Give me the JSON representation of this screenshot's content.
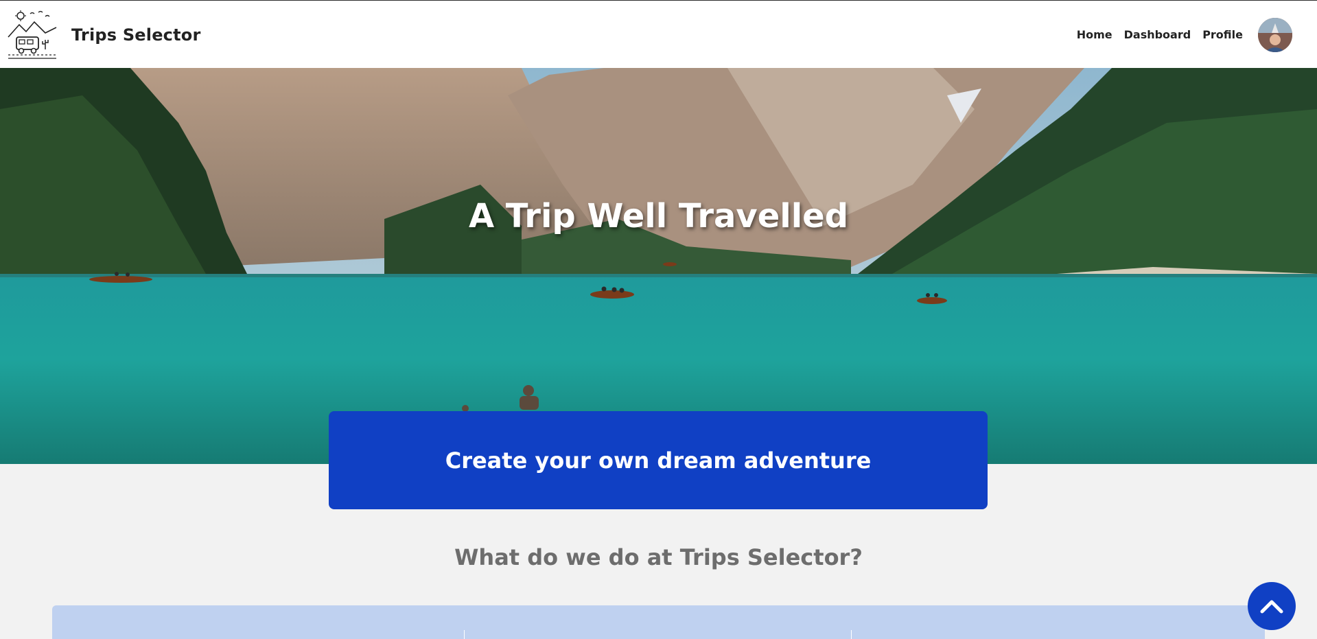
{
  "header": {
    "brand_title": "Trips Selector",
    "logo_icon": "camper-van-mountains-logo",
    "nav": [
      {
        "label": "Home"
      },
      {
        "label": "Dashboard"
      },
      {
        "label": "Profile"
      }
    ],
    "avatar_icon": "user-avatar"
  },
  "hero": {
    "title": "A Trip Well Travelled",
    "image": "mountain-lake-with-boats"
  },
  "cta": {
    "label": "Create your own dream adventure"
  },
  "section": {
    "title": "What do we do at Trips Selector?"
  },
  "scroll_top": {
    "icon": "chevron-up-icon"
  },
  "colors": {
    "primary": "#1040c4",
    "feature_bg": "#bfd1f0",
    "page_bg": "#f2f2f2",
    "section_title": "#6d6d6d"
  }
}
